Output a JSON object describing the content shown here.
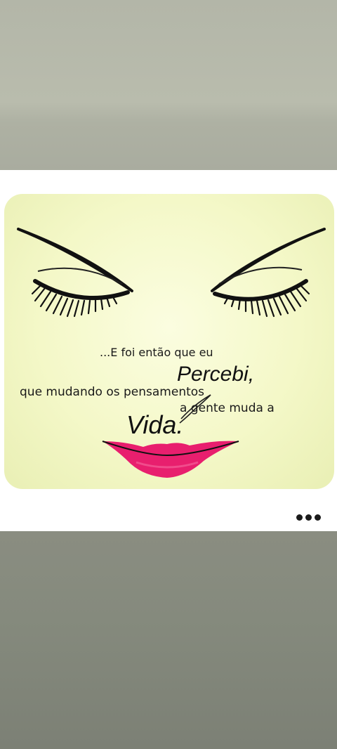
{
  "post": {
    "quote_line_1": "...E foi então que eu",
    "quote_line_2": "Percebi,",
    "quote_line_3": "que mudando os pensamentos",
    "quote_line_4": "a gente muda a",
    "quote_line_5": "Vida.",
    "more_icon": "more-horizontal-icon"
  },
  "colors": {
    "image_background": "#f4f8c8",
    "lips": "#e81f6e",
    "lashes": "#111111",
    "card_background": "#ffffff"
  }
}
